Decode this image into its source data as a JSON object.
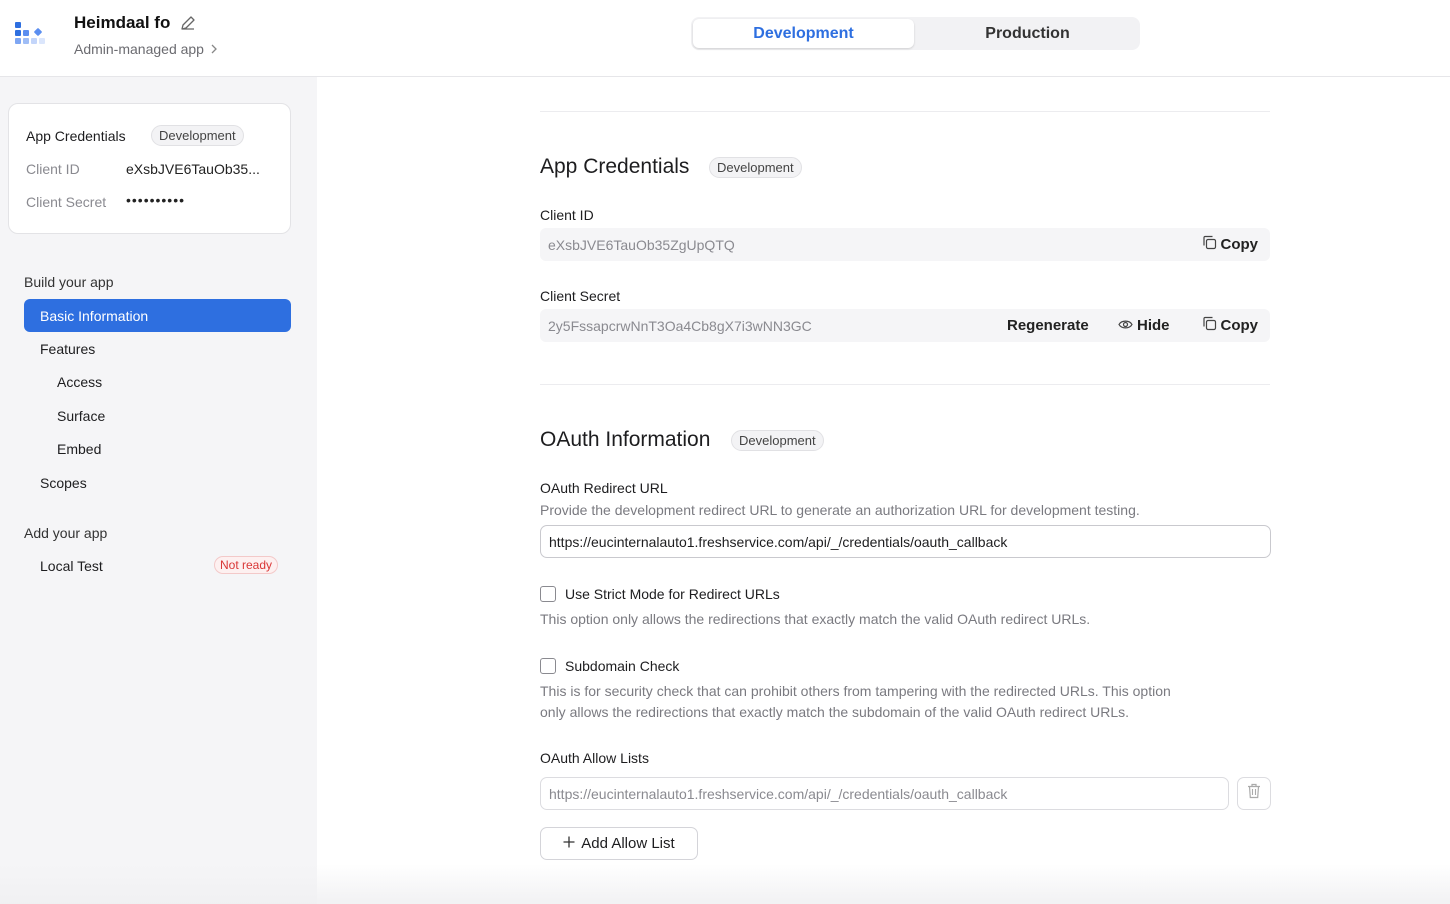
{
  "header": {
    "app_name": "Heimdaal fo",
    "app_subtitle": "Admin-managed app",
    "env_tabs": [
      "Development",
      "Production"
    ]
  },
  "sidebar": {
    "card": {
      "title": "App Credentials",
      "badge": "Development",
      "client_id_label": "Client ID",
      "client_id_value": "eXsbJVE6TauOb35...",
      "client_secret_label": "Client Secret",
      "client_secret_value": "••••••••••"
    },
    "build_section": "Build your app",
    "items": {
      "basic_information": "Basic Information",
      "features": "Features",
      "access": "Access",
      "surface": "Surface",
      "embed": "Embed",
      "scopes": "Scopes"
    },
    "add_section": "Add your app",
    "local_test": "Local Test",
    "not_ready_badge": "Not ready"
  },
  "credentials": {
    "title": "App Credentials",
    "badge": "Development",
    "client_id_label": "Client ID",
    "client_id_value": "eXsbJVE6TauOb35ZgUpQTQ",
    "copy_label": "Copy",
    "client_secret_label": "Client Secret",
    "client_secret_value": "2y5FssapcrwNnT3Oa4Cb8gX7i3wNN3GC",
    "regenerate_label": "Regenerate",
    "hide_label": "Hide"
  },
  "oauth": {
    "title": "OAuth Information",
    "badge": "Development",
    "redirect_label": "OAuth Redirect URL",
    "redirect_help": "Provide the development redirect URL to generate an authorization URL for development testing.",
    "redirect_value": "https://eucinternalauto1.freshservice.com/api/_/credentials/oauth_callback",
    "strict_label": "Use Strict Mode for Redirect URLs",
    "strict_help": "This option only allows the redirections that exactly match the valid OAuth redirect URLs.",
    "subdomain_label": "Subdomain Check",
    "subdomain_help_1": "This is for security check that can prohibit others from tampering with the redirected URLs. This option",
    "subdomain_help_2": "only allows the redirections that exactly match the subdomain of the valid OAuth redirect URLs.",
    "allow_lists_label": "OAuth Allow Lists",
    "allow_list_value": "https://eucinternalauto1.freshservice.com/api/_/credentials/oauth_callback",
    "add_allow_list_label": "Add Allow List"
  },
  "colors": {
    "accent": "#2e6fe0",
    "danger": "#d93636"
  }
}
